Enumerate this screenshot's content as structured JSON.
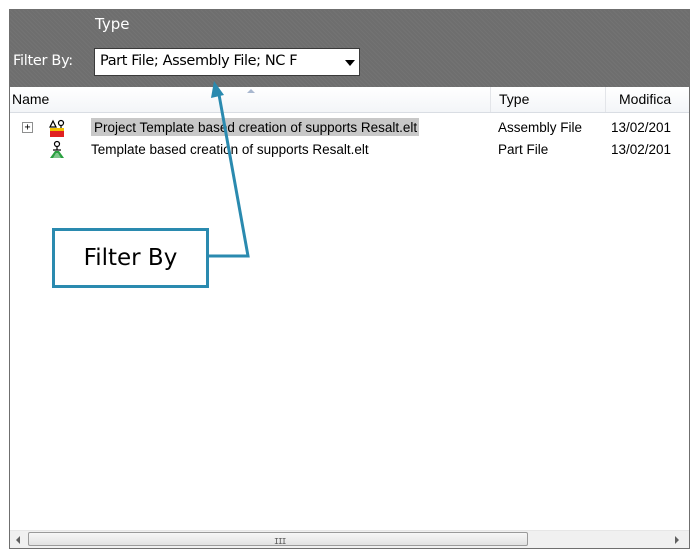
{
  "filter_panel": {
    "column_caption": "Type",
    "filter_label": "Filter By:",
    "filter_value": "Part File; Assembly File; NC F"
  },
  "columns": {
    "name": "Name",
    "type": "Type",
    "modified": "Modifica"
  },
  "rows": [
    {
      "name": "Project Template based creation of supports Resalt.elt",
      "type": "Assembly File",
      "modified": "13/02/201",
      "icon": "assembly-file-icon",
      "expandable": true,
      "expander_glyph": "+",
      "selected": true
    },
    {
      "name": "Template based creation of supports Resalt.elt",
      "type": "Part File",
      "modified": "13/02/201",
      "icon": "part-file-icon",
      "expandable": false,
      "selected": false
    }
  ],
  "annotation": {
    "callout_text": "Filter By",
    "color": "#2a8aaf"
  },
  "scrollbar": {
    "grip": "III"
  },
  "colors": {
    "header_bg": "#6e6e6e",
    "selection_bg": "#c8c8c8",
    "callout": "#2a8aaf"
  }
}
